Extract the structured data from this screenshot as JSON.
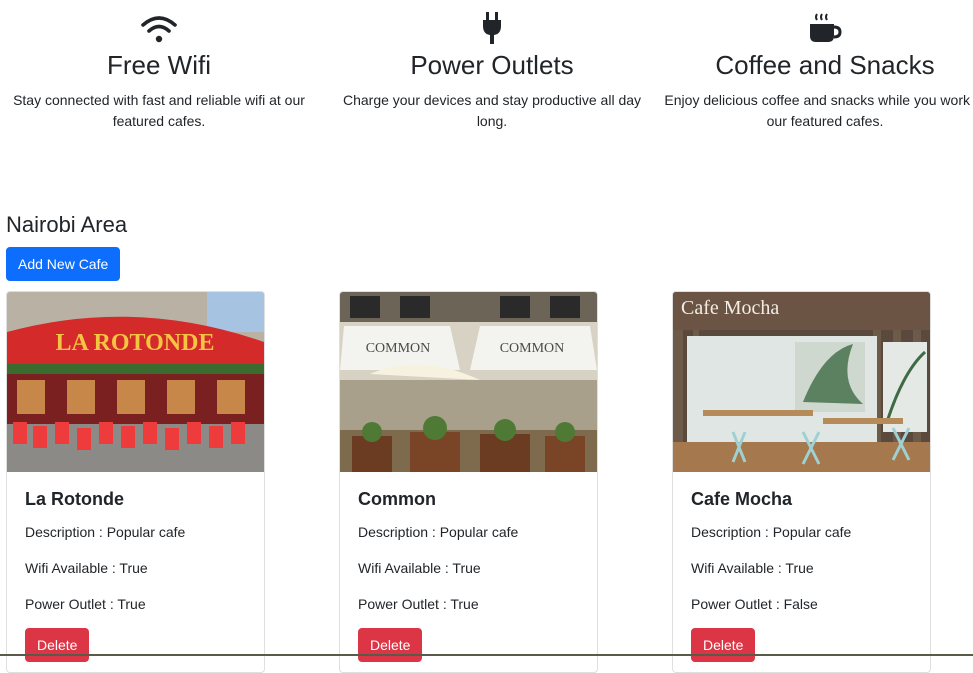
{
  "features": [
    {
      "icon": "wifi-icon",
      "title": "Free Wifi",
      "text": "Stay connected with fast and reliable wifi at our featured cafes."
    },
    {
      "icon": "plug-icon",
      "title": "Power Outlets",
      "text": "Charge your devices and stay productive all day long."
    },
    {
      "icon": "coffee-cup-icon",
      "title": "Coffee and Snacks",
      "text": "Enjoy delicious coffee and snacks while you work at our featured cafes."
    }
  ],
  "section": {
    "title": "Nairobi Area",
    "add_button": "Add New Cafe"
  },
  "cafes": [
    {
      "name": "La Rotonde",
      "description": "Description : Popular cafe",
      "wifi": "Wifi Available : True",
      "power": "Power Outlet : True",
      "delete_label": "Delete",
      "sign": "LA ROTONDE"
    },
    {
      "name": "Common",
      "description": "Description : Popular cafe",
      "wifi": "Wifi Available : True",
      "power": "Power Outlet : True",
      "delete_label": "Delete",
      "sign": "COMMON"
    },
    {
      "name": "Cafe Mocha",
      "description": "Description : Popular cafe",
      "wifi": "Wifi Available : True",
      "power": "Power Outlet : False",
      "delete_label": "Delete",
      "sign": "Cafe Mocha"
    }
  ],
  "colors": {
    "primary": "#0d6efd",
    "danger": "#dc3545",
    "text": "#212529"
  }
}
